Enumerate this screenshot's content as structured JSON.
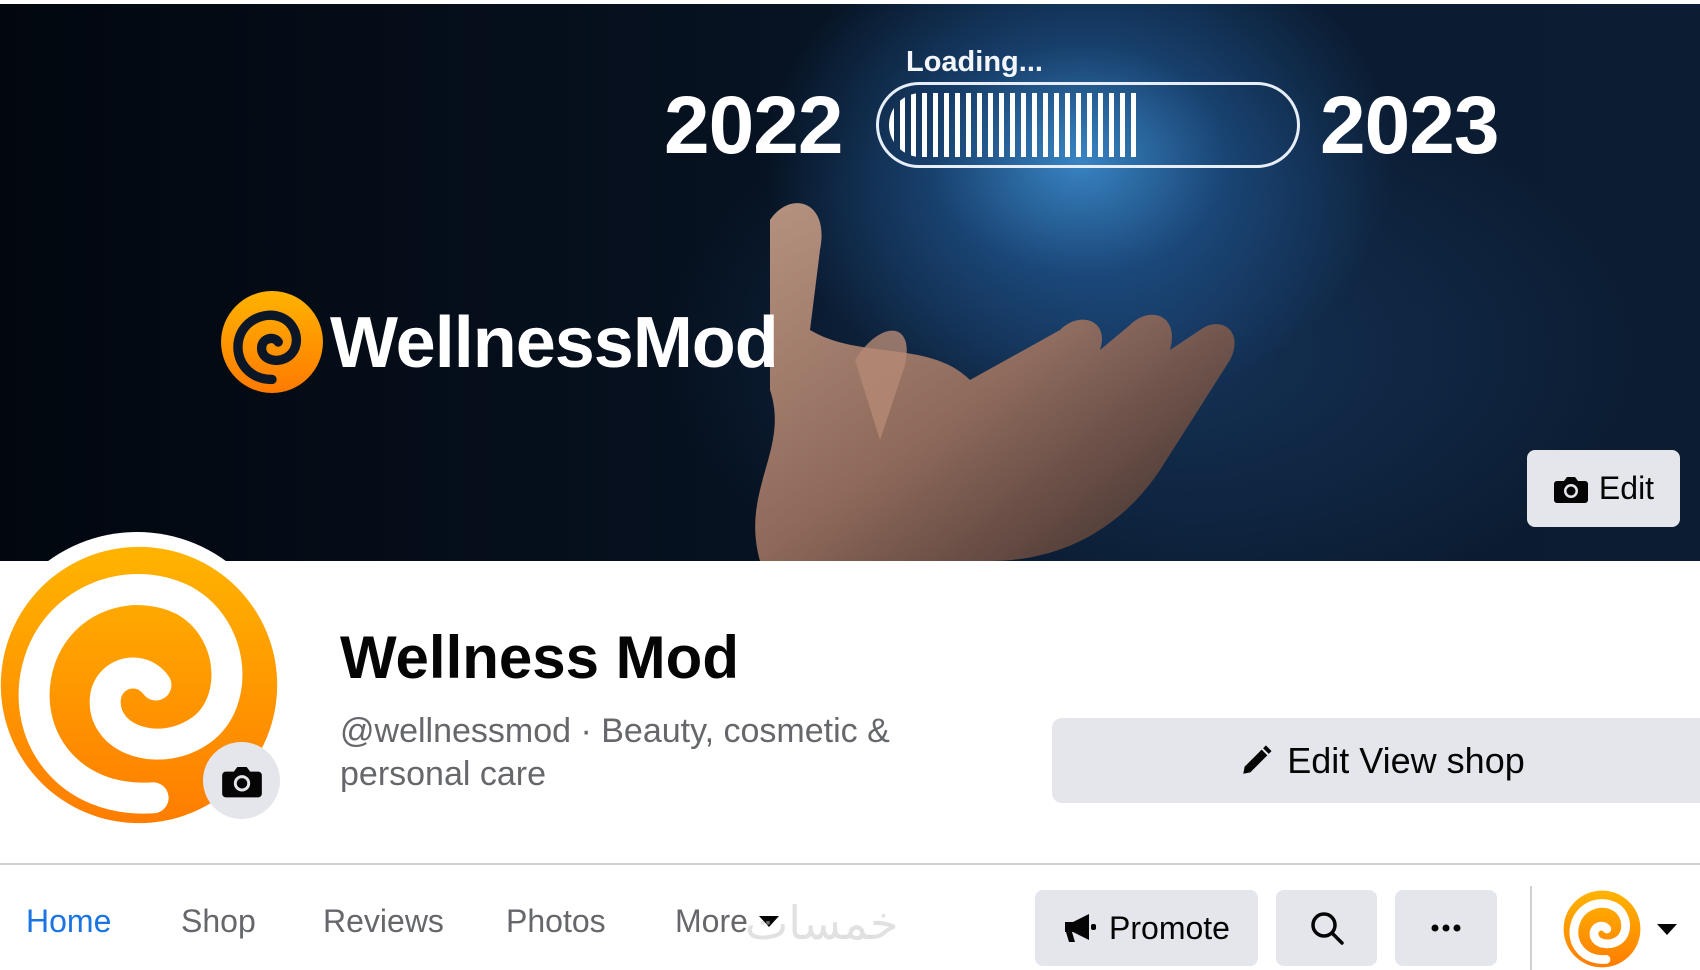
{
  "cover": {
    "loading_text": "Loading...",
    "year_from": "2022",
    "year_to": "2023",
    "brand_text": "WellnessMod",
    "progress_fraction": 0.62,
    "edit_label": "Edit",
    "edit_icon": "camera-icon"
  },
  "profile": {
    "name": "Wellness Mod",
    "subtitle": "@wellnessmod · Beauty, cosmetic & personal care",
    "avatar_colors": [
      "#f5a623",
      "#ff7a00",
      "#ffffff"
    ],
    "camera_icon": "camera-icon"
  },
  "actions": {
    "edit_shop_label": "Edit View shop",
    "edit_shop_icon": "pencil-icon"
  },
  "tabs": [
    {
      "label": "Home",
      "active": true
    },
    {
      "label": "Shop"
    },
    {
      "label": "Reviews"
    },
    {
      "label": "Photos"
    },
    {
      "label": "More"
    }
  ],
  "toolbar": {
    "promote_label": "Promote",
    "promote_icon": "megaphone-icon",
    "search_icon": "search-icon",
    "more_icon": "ellipsis-icon",
    "account_icon": "page-avatar-icon",
    "dropdown_icon": "caret-down-icon"
  },
  "watermark": "خمسات",
  "colors": {
    "accent_blue": "#1b74e4",
    "button_gray": "#e4e6eb",
    "text_dark": "#050505",
    "text_muted": "#65676b",
    "brand_orange": "#f7a21b"
  }
}
